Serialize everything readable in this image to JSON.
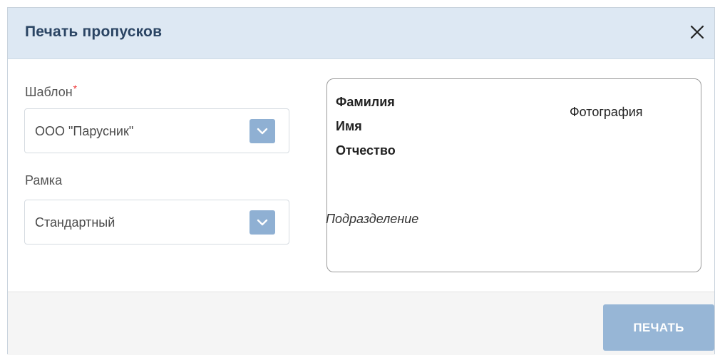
{
  "dialog": {
    "title": "Печать пропусков",
    "close_icon": "close-icon"
  },
  "form": {
    "template": {
      "label": "Шаблон",
      "required_mark": "*",
      "value": "ООО \"Парусник\""
    },
    "frame": {
      "label": "Рамка",
      "value": "Стандартный"
    }
  },
  "preview": {
    "surname": "Фамилия",
    "first_name": "Имя",
    "patronymic": "Отчество",
    "photo": "Фотография",
    "department": "Подразделение"
  },
  "footer": {
    "print_label": "ПЕЧАТЬ"
  },
  "colors": {
    "header_bg": "#dde8f3",
    "title": "#2a4463",
    "accent": "#8fb0d3",
    "button_disabled": "#97b6d6",
    "required": "#ee3333"
  }
}
